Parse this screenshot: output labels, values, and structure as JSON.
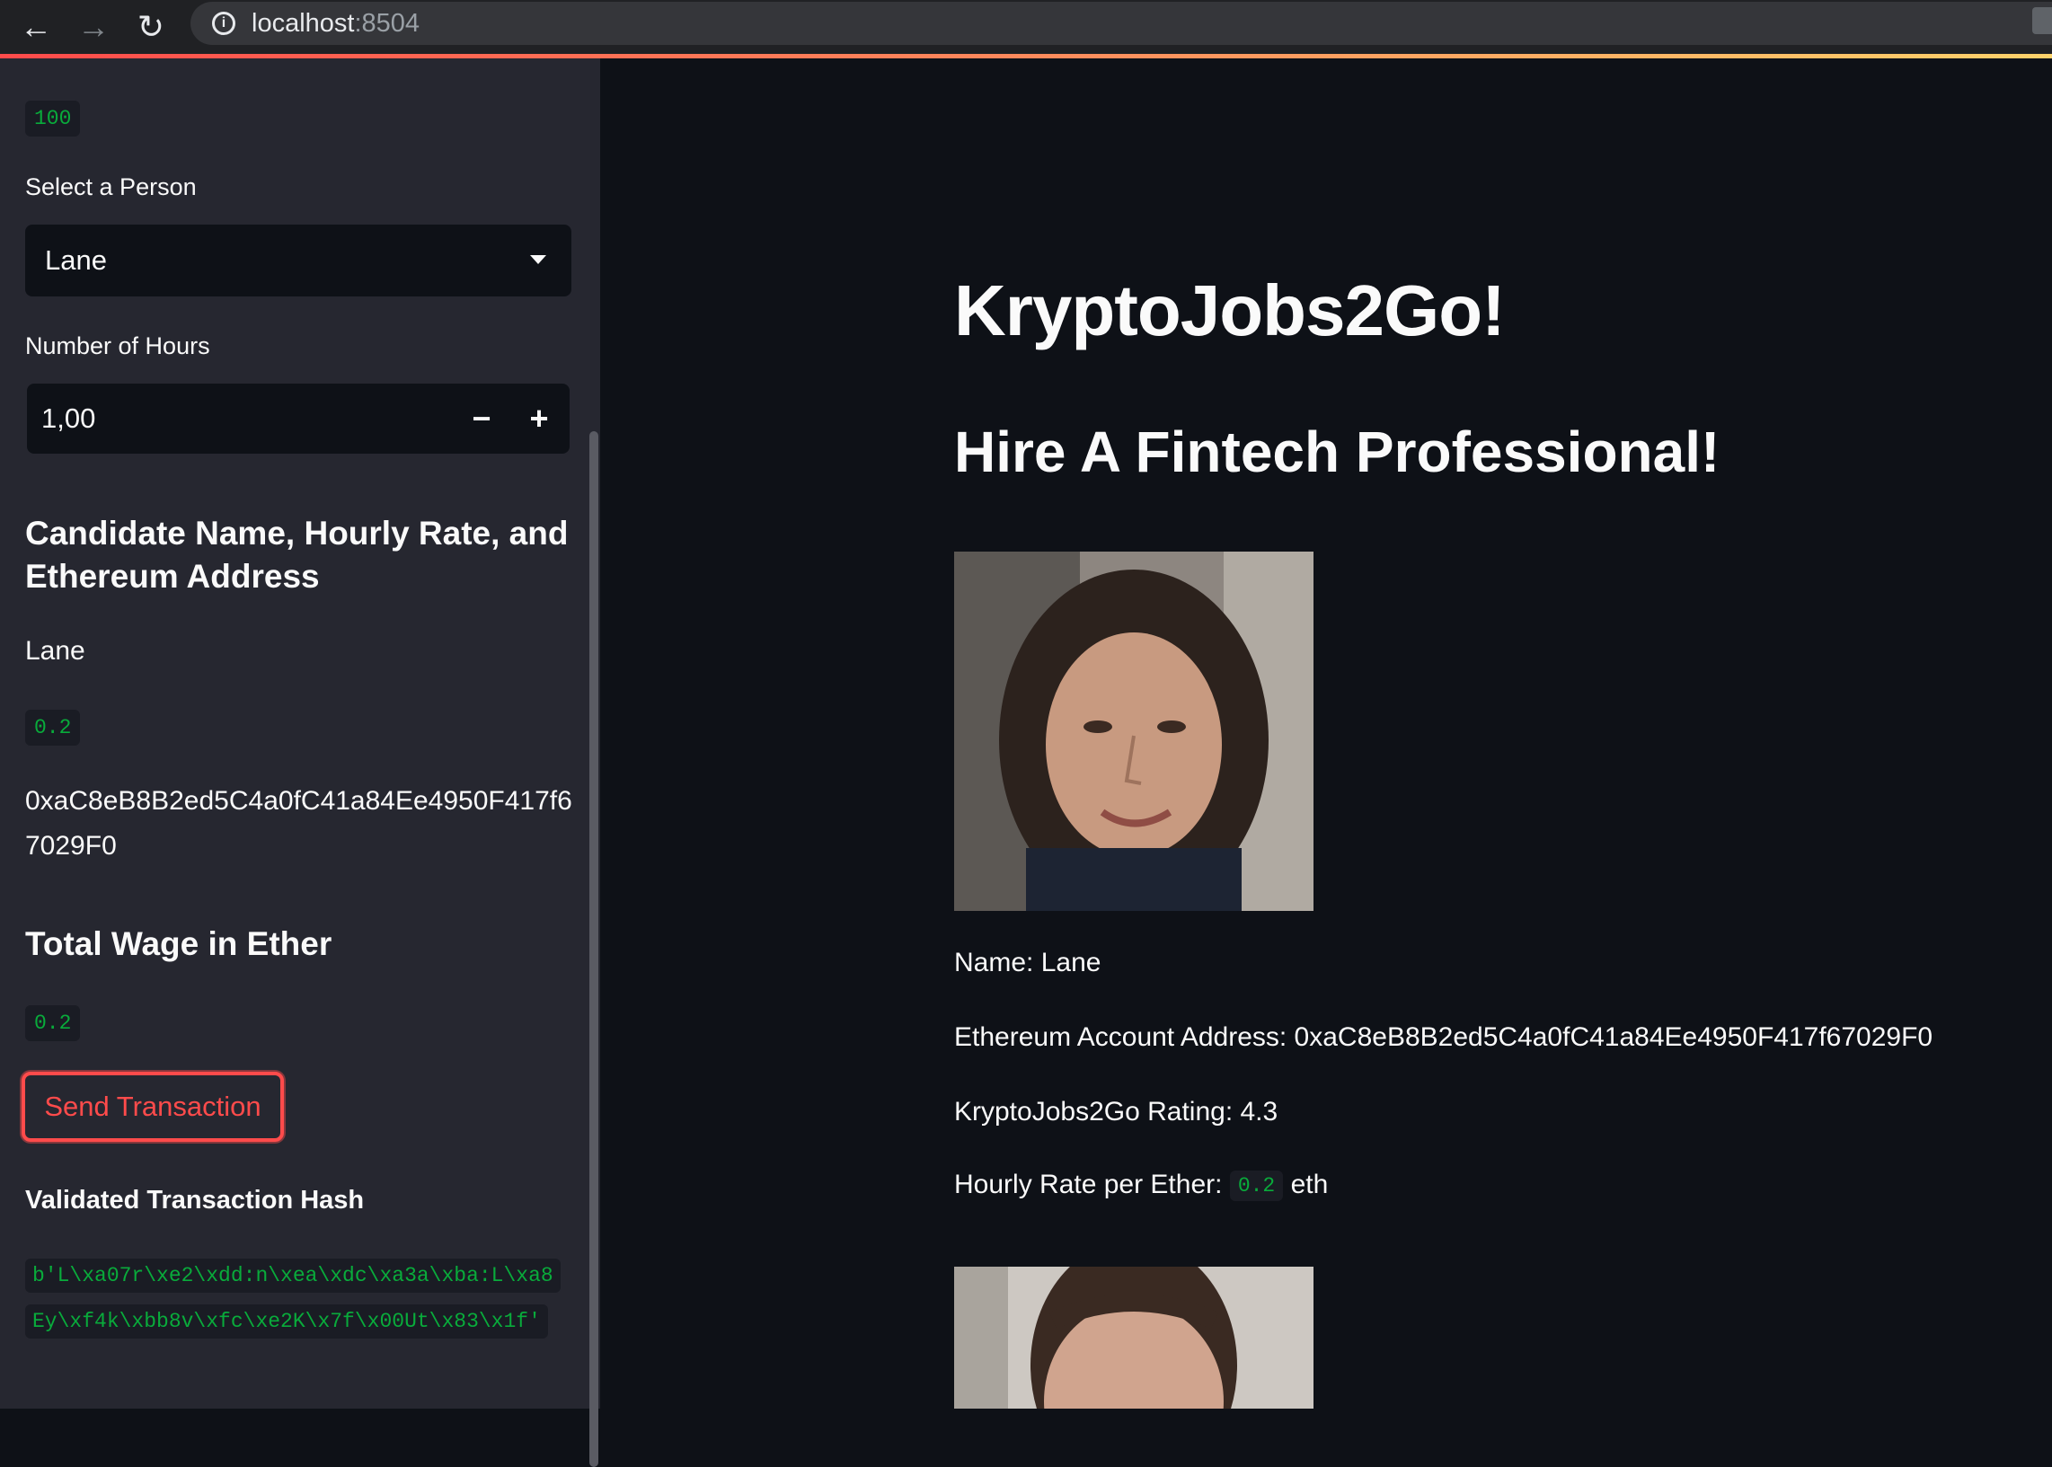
{
  "browser": {
    "back_icon": "back-arrow-icon",
    "forward_icon": "forward-arrow-icon",
    "reload_icon": "reload-icon",
    "url_host": "localhost",
    "url_port": ":8504"
  },
  "sidebar": {
    "top_chip": "100",
    "select_label": "Select a Person",
    "select_value": "Lane",
    "hours_label": "Number of Hours",
    "hours_value": "1,00",
    "minus_label": "−",
    "plus_label": "+",
    "candidate_heading": "Candidate Name, Hourly Rate, and Ethereum Address",
    "candidate_name": "Lane",
    "candidate_rate": "0.2",
    "candidate_address": "0xaC8eB8B2ed5C4a0fC41a84Ee4950F417f67029F0",
    "wage_heading": "Total Wage in Ether",
    "wage_value": "0.2",
    "send_button": "Send Transaction",
    "hash_heading": "Validated Transaction Hash",
    "hash_value": "b'L\\xa07r\\xe2\\xdd:n\\xea\\xdc\\xa3a\\xba:L\\xa8Ey\\xf4k\\xbb8v\\xfc\\xe2K\\x7f\\x00Ut\\x83\\x1f'"
  },
  "main": {
    "title": "KryptoJobs2Go!",
    "subtitle": "Hire A Fintech Professional!",
    "candidates": [
      {
        "name_line": "Name: Lane",
        "address_line": "Ethereum Account Address: 0xaC8eB8B2ed5C4a0fC41a84Ee4950F417f67029F0",
        "rating_line": "KryptoJobs2Go Rating: 4.3",
        "rate_prefix": "Hourly Rate per Ether:",
        "rate_value": "0.2",
        "rate_suffix": "eth"
      }
    ]
  },
  "colors": {
    "accent": "#ff4b4b",
    "code_green": "#09ab3b",
    "sidebar_bg": "#262730",
    "main_bg": "#0e1117"
  }
}
